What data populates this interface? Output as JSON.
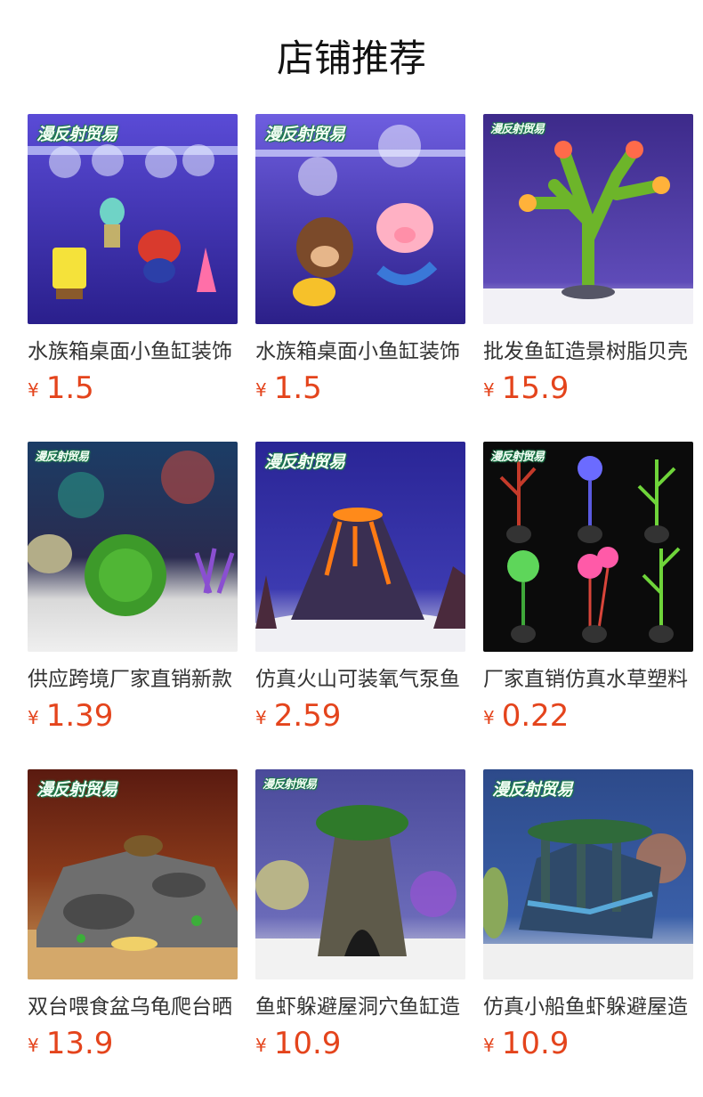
{
  "header": {
    "title": "店铺推荐"
  },
  "products": [
    {
      "name": "水族箱桌面小鱼缸装饰",
      "currency": "¥",
      "price": "1.5",
      "watermark": "漫反射贸易",
      "colors": {
        "bg": "#3c2fb4"
      }
    },
    {
      "name": "水族箱桌面小鱼缸装饰",
      "currency": "¥",
      "price": "1.5",
      "watermark": "漫反射贸易",
      "colors": {
        "bg": "#3b2b9e"
      }
    },
    {
      "name": "批发鱼缸造景树脂贝壳",
      "currency": "¥",
      "price": "15.9",
      "watermark": "漫反射贸易",
      "colors": {
        "bg": "#30206e"
      }
    },
    {
      "name": "供应跨境厂家直销新款",
      "currency": "¥",
      "price": "1.39",
      "watermark": "漫反射贸易",
      "colors": {
        "bg": "#1d2f55"
      }
    },
    {
      "name": "仿真火山可装氧气泵鱼",
      "currency": "¥",
      "price": "2.59",
      "watermark": "漫反射贸易",
      "colors": {
        "bg": "#1f2a8a"
      }
    },
    {
      "name": "厂家直销仿真水草塑料",
      "currency": "¥",
      "price": "0.22",
      "watermark": "漫反射贸易",
      "colors": {
        "bg": "#0d0d0d"
      }
    },
    {
      "name": "双台喂食盆乌龟爬台晒",
      "currency": "¥",
      "price": "13.9",
      "watermark": "漫反射贸易",
      "colors": {
        "bg": "#4a1a10"
      }
    },
    {
      "name": "鱼虾躲避屋洞穴鱼缸造",
      "currency": "¥",
      "price": "10.9",
      "watermark": "漫反射贸易",
      "colors": {
        "bg": "#5b5aa8"
      }
    },
    {
      "name": "仿真小船鱼虾躲避屋造",
      "currency": "¥",
      "price": "10.9",
      "watermark": "漫反射贸易",
      "colors": {
        "bg": "#234f86"
      }
    }
  ]
}
